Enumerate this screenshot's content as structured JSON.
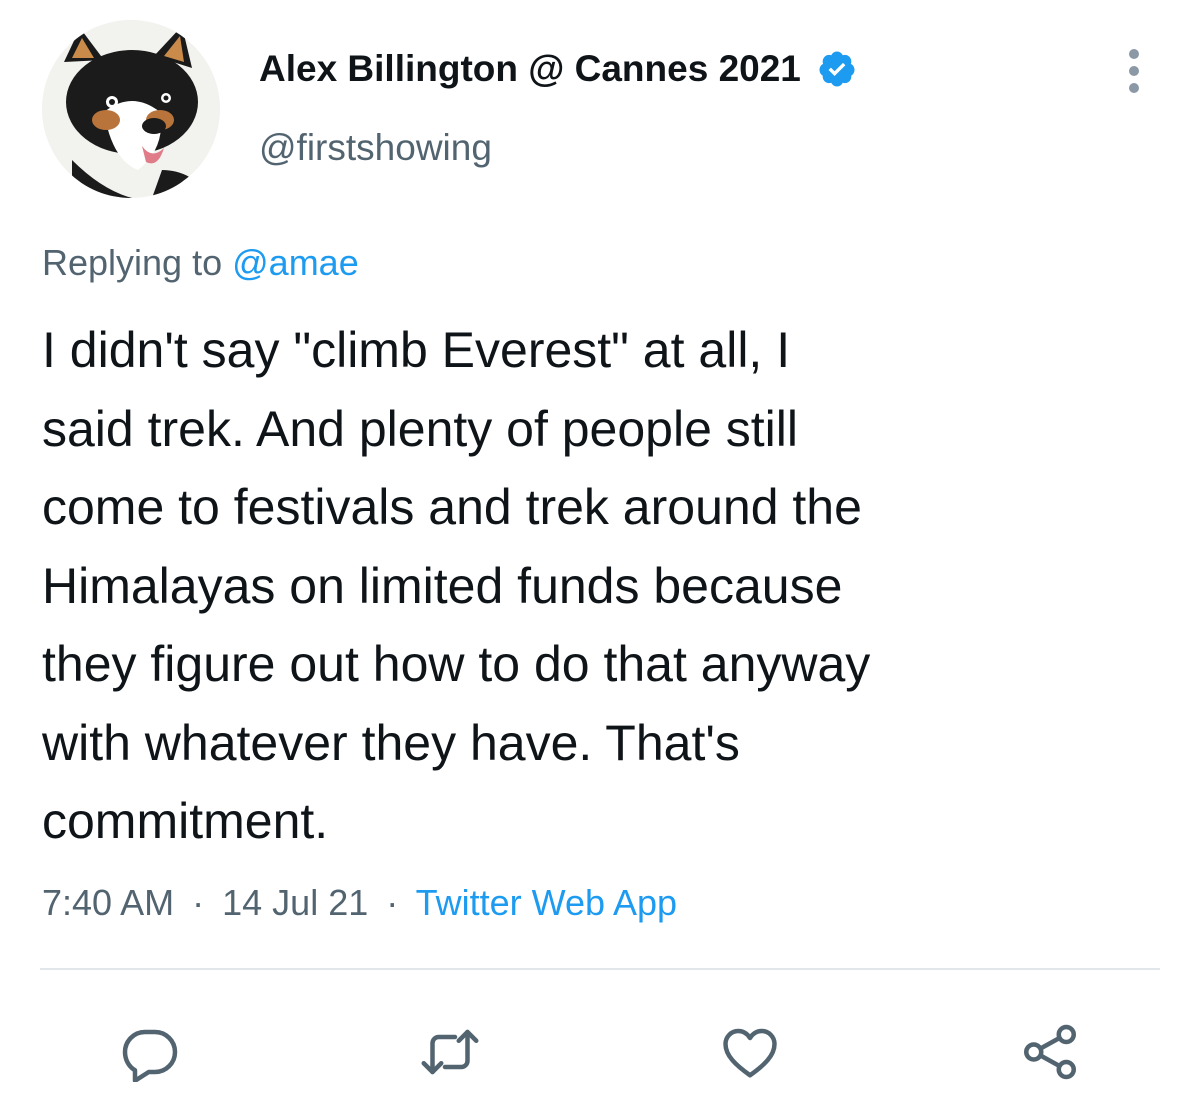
{
  "tweet": {
    "author": {
      "display_name": "Alex Billington @ Cannes 2021",
      "handle": "@firstshowing",
      "verified": true,
      "avatar_icon": "husky-dog-avatar"
    },
    "reply_context": {
      "prefix": "Replying to",
      "mention": "@amae"
    },
    "text_lines": [
      "I didn't say \"climb Everest\" at all, I",
      "said trek. And plenty of people still",
      "come to festivals and trek around the",
      "Himalayas on limited funds because",
      "they figure out how to do that anyway",
      "with whatever they have. That's",
      "commitment."
    ],
    "timestamp": {
      "time": "7:40 AM",
      "separator": "·",
      "date": "14 Jul 21",
      "source": "Twitter Web App"
    },
    "actions": [
      {
        "name": "reply",
        "icon": "reply-icon"
      },
      {
        "name": "retweet",
        "icon": "retweet-icon"
      },
      {
        "name": "like",
        "icon": "heart-icon"
      },
      {
        "name": "share",
        "icon": "share-icon"
      }
    ]
  },
  "colors": {
    "text_primary": "#0f1419",
    "text_secondary": "#536471",
    "accent": "#1d9bf0",
    "divider": "#e1e6ea"
  }
}
